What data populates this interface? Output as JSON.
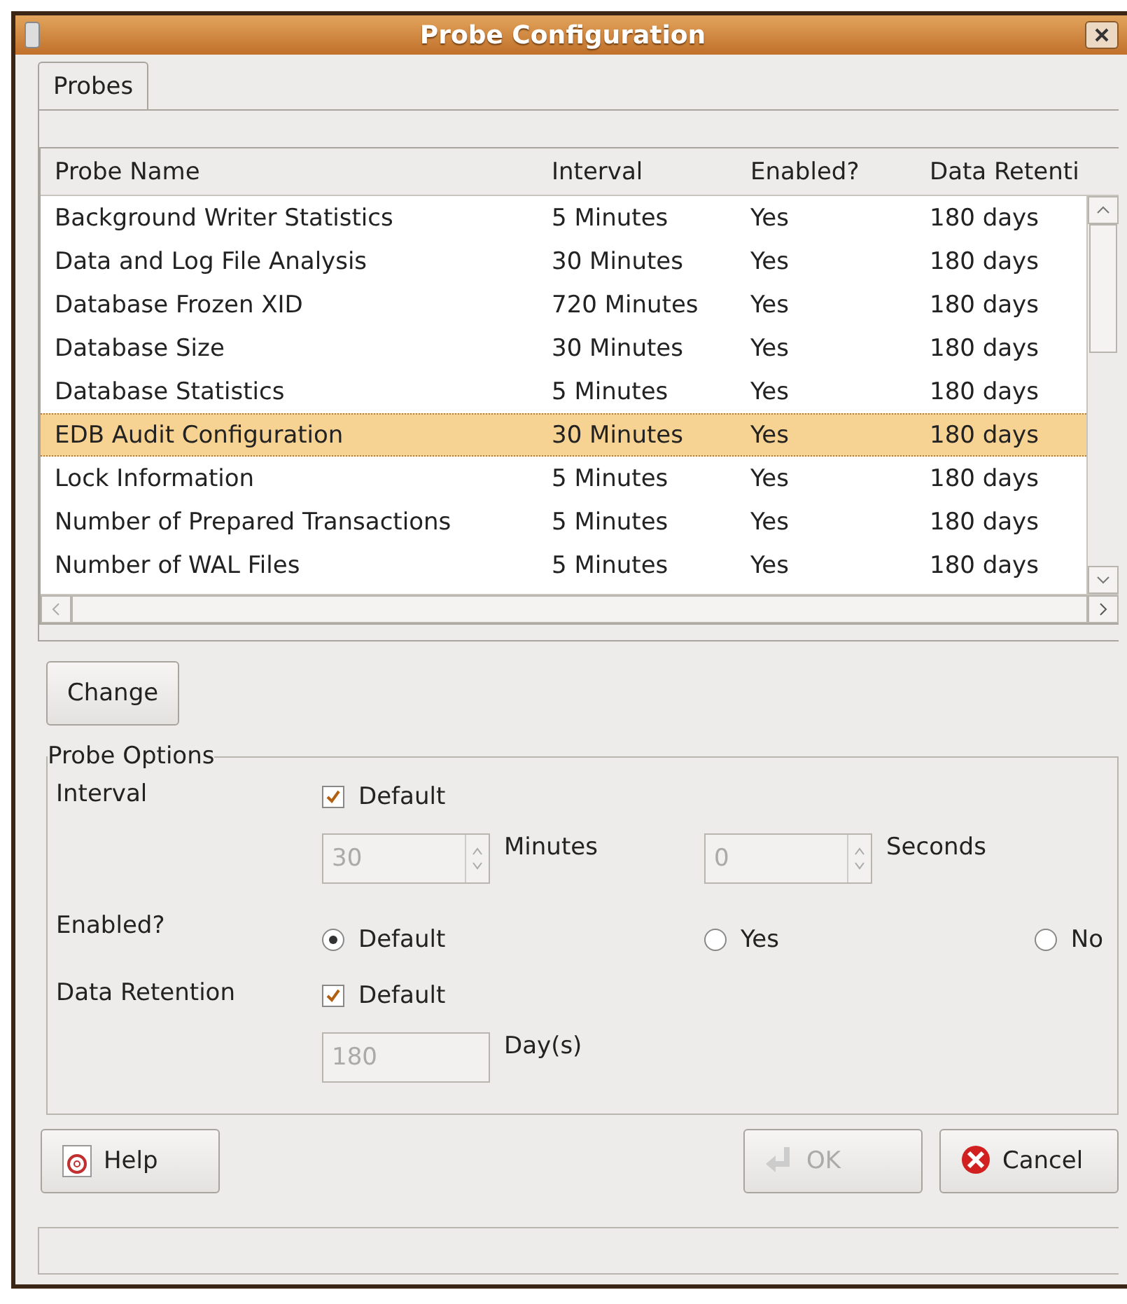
{
  "window": {
    "title": "Probe Configuration"
  },
  "tabs": [
    {
      "label": "Probes",
      "selected": true
    }
  ],
  "table": {
    "columns": [
      "Probe Name",
      "Interval",
      "Enabled?",
      "Data Retenti"
    ],
    "rows": [
      {
        "cells": [
          "Background Writer Statistics",
          "5 Minutes",
          "Yes",
          "180 days"
        ],
        "selected": false
      },
      {
        "cells": [
          "Data and Log File Analysis",
          "30 Minutes",
          "Yes",
          "180 days"
        ],
        "selected": false
      },
      {
        "cells": [
          "Database Frozen XID",
          "720 Minutes",
          "Yes",
          "180 days"
        ],
        "selected": false
      },
      {
        "cells": [
          "Database Size",
          "30 Minutes",
          "Yes",
          "180 days"
        ],
        "selected": false
      },
      {
        "cells": [
          "Database Statistics",
          "5 Minutes",
          "Yes",
          "180 days"
        ],
        "selected": false
      },
      {
        "cells": [
          "EDB Audit Configuration",
          "30 Minutes",
          "Yes",
          "180 days"
        ],
        "selected": true
      },
      {
        "cells": [
          "Lock Information",
          "5 Minutes",
          "Yes",
          "180 days"
        ],
        "selected": false
      },
      {
        "cells": [
          "Number of Prepared Transactions",
          "5 Minutes",
          "Yes",
          "180 days"
        ],
        "selected": false
      },
      {
        "cells": [
          "Number of WAL Files",
          "5 Minutes",
          "Yes",
          "180 days"
        ],
        "selected": false
      }
    ]
  },
  "change_button": {
    "label": "Change"
  },
  "probe_options": {
    "title": "Probe Options",
    "interval": {
      "label": "Interval",
      "default": {
        "label": "Default",
        "checked": true
      },
      "spinners": [
        {
          "value": "30",
          "unit": "Minutes",
          "disabled": true
        },
        {
          "value": "0",
          "unit": "Seconds",
          "disabled": true
        }
      ]
    },
    "enabled": {
      "label": "Enabled?",
      "options": [
        {
          "label": "Default",
          "selected": true
        },
        {
          "label": "Yes",
          "selected": false
        },
        {
          "label": "No",
          "selected": false
        }
      ]
    },
    "retention": {
      "label": "Data Retention",
      "default": {
        "label": "Default",
        "checked": true
      },
      "field": {
        "value": "180",
        "unit": "Day(s)",
        "disabled": true
      }
    }
  },
  "buttons": [
    {
      "label": "Help",
      "kind": "help",
      "disabled": false
    },
    {
      "label": "OK",
      "kind": "ok",
      "disabled": true
    },
    {
      "label": "Cancel",
      "kind": "cancel",
      "disabled": false
    }
  ]
}
